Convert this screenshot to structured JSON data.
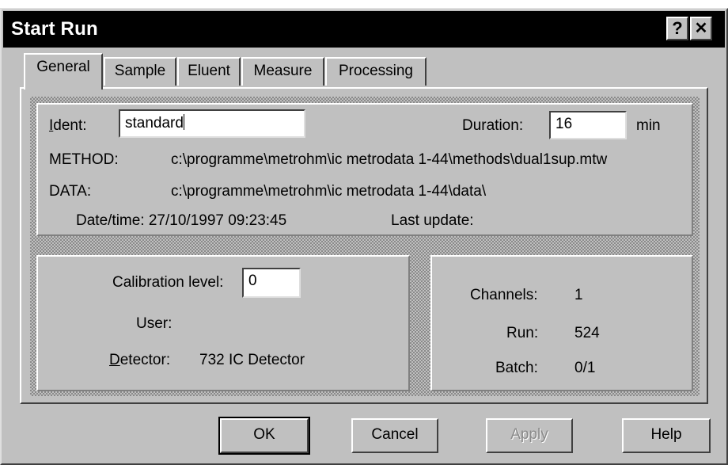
{
  "window": {
    "title": "Start Run",
    "help_glyph": "?",
    "close_glyph": "✕"
  },
  "tabs": [
    {
      "label": "General",
      "active": true
    },
    {
      "label": "Sample"
    },
    {
      "label": "Eluent"
    },
    {
      "label": "Measure"
    },
    {
      "label": "Processing"
    }
  ],
  "general": {
    "ident_label_ul": "I",
    "ident_label_rest": "dent:",
    "ident_value": "standard",
    "duration_label": "Duration:",
    "duration_value": "16",
    "duration_unit": "min",
    "method_label": "METHOD:",
    "method_value": "c:\\programme\\metrohm\\ic metrodata 1-44\\methods\\dual1sup.mtw",
    "data_label": "DATA:",
    "data_value": "c:\\programme\\metrohm\\ic metrodata 1-44\\data\\",
    "datetime_text": "Date/time: 27/10/1997 09:23:45",
    "last_update_label": "Last update:"
  },
  "calibration": {
    "level_label": "Calibration level:",
    "level_value": "0",
    "user_label": "User:",
    "detector_label_ul": "D",
    "detector_label_rest": "etector:",
    "detector_value": "732 IC Detector"
  },
  "stats": {
    "channels_label": "Channels:",
    "channels_value": "1",
    "run_label": "Run:",
    "run_value": "524",
    "batch_label": "Batch:",
    "batch_value": "0/1"
  },
  "buttons": {
    "ok": "OK",
    "cancel": "Cancel",
    "apply": "Apply",
    "help": "Help"
  }
}
